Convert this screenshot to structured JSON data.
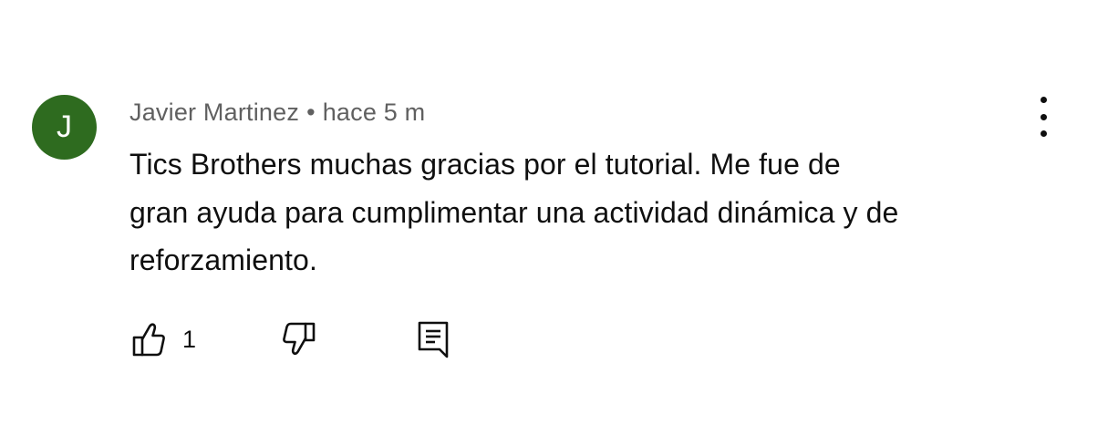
{
  "comment": {
    "avatar_letter": "J",
    "avatar_color": "#2e6b1f",
    "author": "Javier Martinez",
    "separator": "•",
    "timestamp": "hace 5 m",
    "text_lines": [
      "Tics Brothers muchas gracias por el tutorial. Me fue de",
      "gran ayuda para cumplimentar una actividad dinámica y de",
      "reforzamiento."
    ],
    "like_count": "1",
    "icons": {
      "more": "more-vertical-icon",
      "like": "thumbs-up-icon",
      "dislike": "thumbs-down-icon",
      "reply": "reply-comment-icon"
    }
  }
}
